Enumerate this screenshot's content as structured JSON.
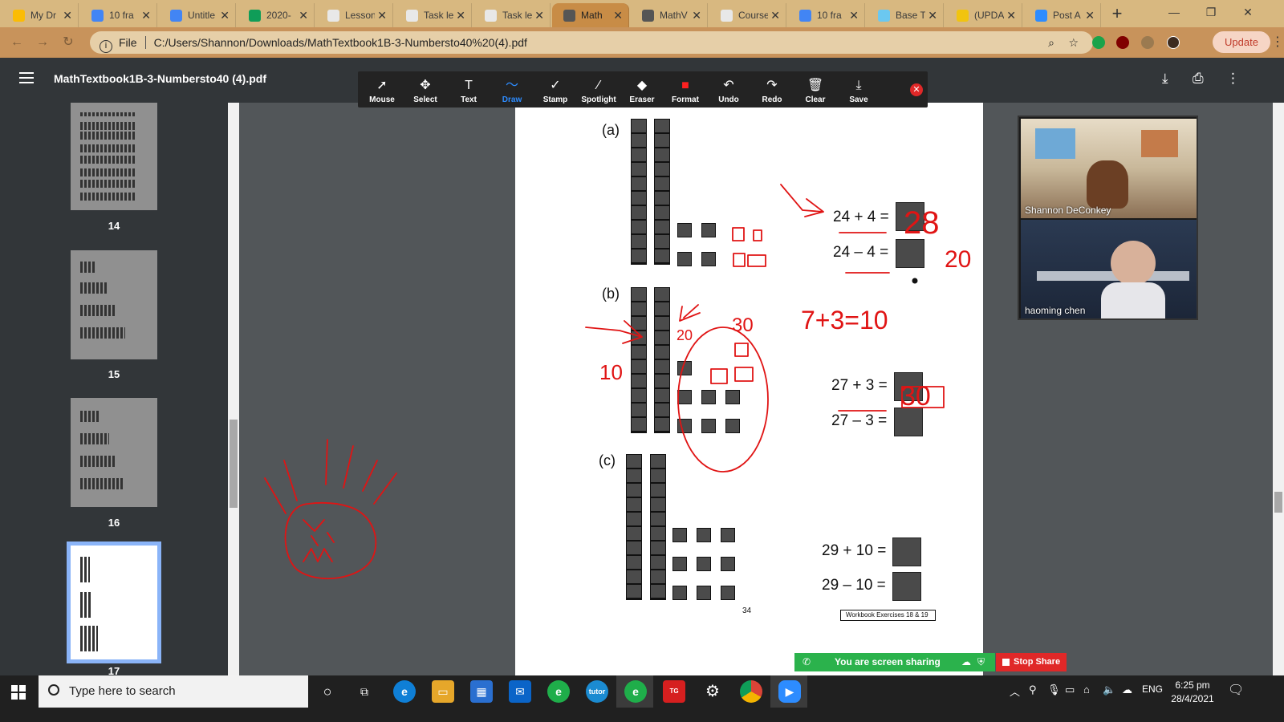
{
  "browser": {
    "tabs": [
      {
        "label": "My Dr",
        "color": "#fbbc04"
      },
      {
        "label": "10 fra",
        "color": "#4285f4"
      },
      {
        "label": "Untitle",
        "color": "#4285f4"
      },
      {
        "label": "2020-",
        "color": "#0f9d58"
      },
      {
        "label": "Lesson",
        "color": "#e8e8e8"
      },
      {
        "label": "Task le",
        "color": "#e8e8e8"
      },
      {
        "label": "Task le",
        "color": "#e8e8e8"
      },
      {
        "label": "Math",
        "color": "#555555"
      },
      {
        "label": "MathV",
        "color": "#555555"
      },
      {
        "label": "Course",
        "color": "#e8e8e8"
      },
      {
        "label": "10 fra",
        "color": "#4285f4"
      },
      {
        "label": "Base T",
        "color": "#6bc8f0"
      },
      {
        "label": "(UPDA",
        "color": "#f1c40f"
      },
      {
        "label": "Post A",
        "color": "#2d8cff"
      }
    ],
    "active_tab_index": 7,
    "address": {
      "scheme": "File",
      "url": "C:/Users/Shannon/Downloads/MathTextbook1B-3-Numbersto40%20(4).pdf"
    },
    "update_label": "Update"
  },
  "pdf": {
    "title": "MathTextbook1B-3-Numbersto40 (4).pdf",
    "thumbnails": [
      {
        "page": "14"
      },
      {
        "page": "15"
      },
      {
        "page": "16"
      },
      {
        "page": "17",
        "selected": true
      }
    ]
  },
  "annotate_toolbar": {
    "tools": [
      {
        "label": "Mouse",
        "icon": "mouse-pointer-icon",
        "glyph": "➚"
      },
      {
        "label": "Select",
        "icon": "move-icon",
        "glyph": "✥"
      },
      {
        "label": "Text",
        "icon": "text-icon",
        "glyph": "T"
      },
      {
        "label": "Draw",
        "icon": "draw-icon",
        "glyph": "〜",
        "active": true
      },
      {
        "label": "Stamp",
        "icon": "stamp-check-icon",
        "glyph": "✓"
      },
      {
        "label": "Spotlight",
        "icon": "spotlight-wand-icon",
        "glyph": "⁄"
      },
      {
        "label": "Eraser",
        "icon": "eraser-icon",
        "glyph": "◆"
      },
      {
        "label": "Format",
        "icon": "format-color-icon",
        "glyph": "■"
      },
      {
        "label": "Undo",
        "icon": "undo-icon",
        "glyph": "↶"
      },
      {
        "label": "Redo",
        "icon": "redo-icon",
        "glyph": "↷"
      },
      {
        "label": "Clear",
        "icon": "trash-icon",
        "glyph": "🗑"
      },
      {
        "label": "Save",
        "icon": "save-download-icon",
        "glyph": "⤓"
      }
    ],
    "format_color": "#ff2020"
  },
  "page": {
    "parts": [
      {
        "label": "(a)",
        "equations": [
          "24 + 4 =",
          "24 – 4 ="
        ]
      },
      {
        "label": "(b)",
        "equations": [
          "27 + 3 =",
          "27 – 3 ="
        ]
      },
      {
        "label": "(c)",
        "equations": [
          "29 + 10 =",
          "29 – 10 ="
        ]
      }
    ],
    "page_number": "34",
    "workbook_ref": "Workbook Exercises 18 & 19"
  },
  "annotations": {
    "a_answer_1": "28",
    "a_answer_2": "20",
    "b_sum": "7+3=10",
    "b_answer_1": "30",
    "b_circle_label": "30",
    "b_rod_label": "20",
    "b_left_label": "10"
  },
  "video": {
    "participants": [
      {
        "name": "Shannon DeConkey"
      },
      {
        "name": "haoming chen"
      }
    ]
  },
  "sharing": {
    "status": "You are screen sharing",
    "stop_label": "Stop Share"
  },
  "taskbar": {
    "search_placeholder": "Type here to search",
    "language": "ENG",
    "time": "6:25 pm",
    "date": "28/4/2021"
  }
}
